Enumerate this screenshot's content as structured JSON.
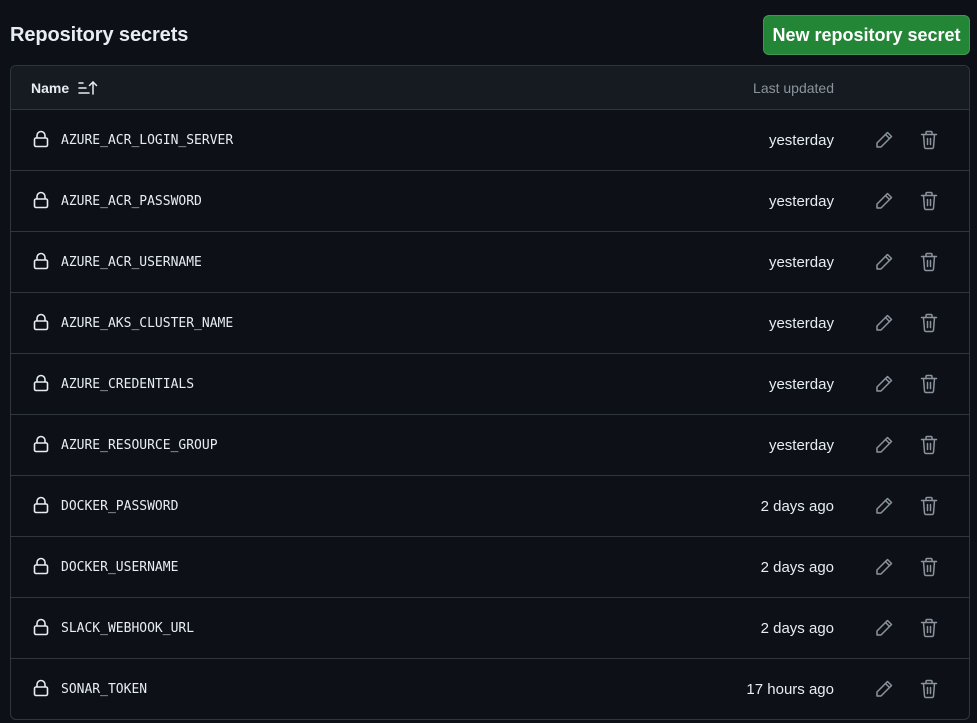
{
  "section": {
    "title": "Repository secrets",
    "new_button_label": "New repository secret"
  },
  "table": {
    "headers": {
      "name": "Name",
      "last_updated": "Last updated"
    },
    "sort": "ascending",
    "rows": [
      {
        "name": "AZURE_ACR_LOGIN_SERVER",
        "updated": "yesterday"
      },
      {
        "name": "AZURE_ACR_PASSWORD",
        "updated": "yesterday"
      },
      {
        "name": "AZURE_ACR_USERNAME",
        "updated": "yesterday"
      },
      {
        "name": "AZURE_AKS_CLUSTER_NAME",
        "updated": "yesterday"
      },
      {
        "name": "AZURE_CREDENTIALS",
        "updated": "yesterday"
      },
      {
        "name": "AZURE_RESOURCE_GROUP",
        "updated": "yesterday"
      },
      {
        "name": "DOCKER_PASSWORD",
        "updated": "2 days ago"
      },
      {
        "name": "DOCKER_USERNAME",
        "updated": "2 days ago"
      },
      {
        "name": "SLACK_WEBHOOK_URL",
        "updated": "2 days ago"
      },
      {
        "name": "SONAR_TOKEN",
        "updated": "17 hours ago"
      }
    ]
  },
  "icons": {
    "row_icon": "lock-icon",
    "row_actions": [
      "pencil-icon",
      "trash-icon"
    ],
    "sort_icon": "sort-ascending-icon"
  },
  "colors": {
    "background": "#0d1117",
    "header_background": "#161b22",
    "border": "#30363d",
    "primary_button": "#238636",
    "muted_text": "#8b949e",
    "icon": "#8b949e"
  }
}
